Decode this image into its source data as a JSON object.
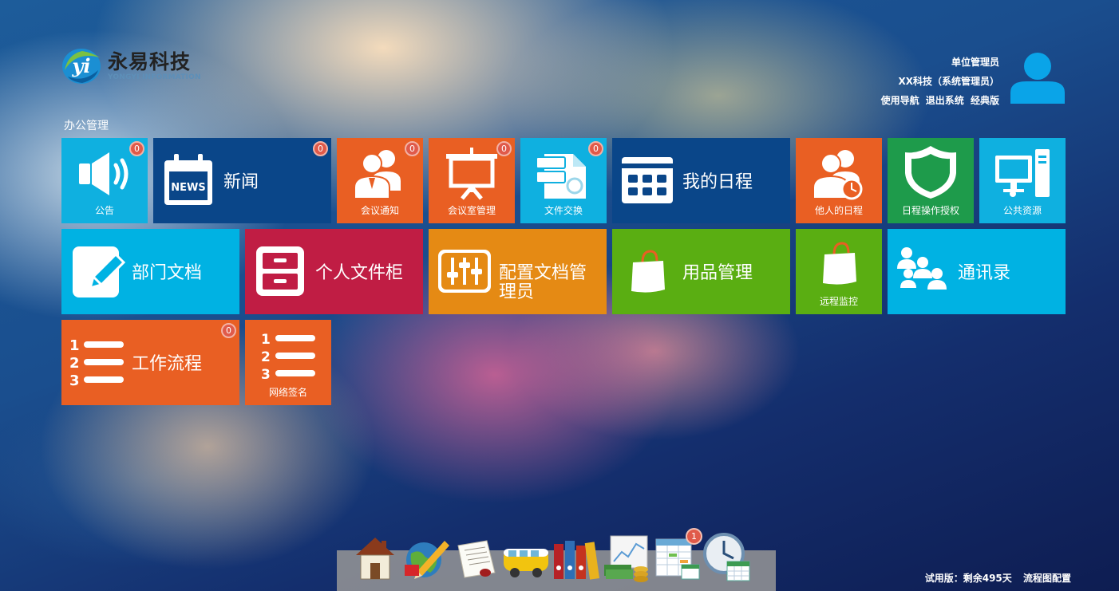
{
  "brand": {
    "name_cn": "永易科技",
    "name_en": "YONGYI INFORMATION",
    "mark": "yi"
  },
  "user": {
    "role": "单位管理员",
    "org": "XX科技（系统管理员）",
    "links": [
      "使用导航",
      "退出系统",
      "经典版"
    ]
  },
  "section": {
    "title": "办公管理"
  },
  "tiles": [
    {
      "label": "公告",
      "badge": "0",
      "color": "#0fb0e0",
      "icon": "speaker-icon"
    },
    {
      "label": "新闻",
      "badge": "0",
      "color": "#0a4689",
      "icon": "news-calendar-icon",
      "icon_text": "NEWS"
    },
    {
      "label": "会议通知",
      "badge": "0",
      "color": "#e95f23",
      "icon": "meeting-people-icon"
    },
    {
      "label": "会议室管理",
      "badge": "0",
      "color": "#e95f23",
      "icon": "presentation-board-icon"
    },
    {
      "label": "文件交换",
      "badge": "0",
      "color": "#0fb0e0",
      "icon": "file-exchange-icon"
    },
    {
      "label": "我的日程",
      "color": "#0a4689",
      "icon": "schedule-grid-icon"
    },
    {
      "label": "他人的日程",
      "color": "#e95f23",
      "icon": "people-clock-icon"
    },
    {
      "label": "日程操作授权",
      "color": "#1e9b4b",
      "icon": "shield-icon"
    },
    {
      "label": "公共资源",
      "color": "#0fb0e0",
      "icon": "computer-icon"
    },
    {
      "label": "部门文档",
      "color": "#00b2e3",
      "icon": "edit-document-icon"
    },
    {
      "label": "个人文件柜",
      "color": "#c01d44",
      "icon": "cabinet-icon"
    },
    {
      "label": "配置文档管理员",
      "color": "#e58a14",
      "icon": "sliders-icon"
    },
    {
      "label": "用品管理",
      "color": "#5aae12",
      "icon": "shopping-bag-icon"
    },
    {
      "label": "远程监控",
      "color": "#5aae12",
      "icon": "shopping-bag-icon"
    },
    {
      "label": "通讯录",
      "color": "#00b2e3",
      "icon": "contacts-group-icon"
    },
    {
      "label": "工作流程",
      "badge": "0",
      "color": "#e95f23",
      "icon": "numbered-list-icon",
      "icon_text": [
        "1",
        "2",
        "3"
      ]
    },
    {
      "label": "网络签名",
      "color": "#e95f23",
      "icon": "numbered-list-icon",
      "icon_text": [
        "1",
        "2",
        "3"
      ]
    }
  ],
  "dock": [
    {
      "name": "home-icon"
    },
    {
      "name": "globe-pencil-icon"
    },
    {
      "name": "letter-seal-icon"
    },
    {
      "name": "bus-icon"
    },
    {
      "name": "binders-icon"
    },
    {
      "name": "chart-money-icon"
    },
    {
      "name": "table-calendar-icon",
      "badge": "1"
    },
    {
      "name": "clock-calendar-icon"
    }
  ],
  "footer": {
    "trial": "试用版：剩余495天",
    "flow_config": "流程图配置"
  }
}
